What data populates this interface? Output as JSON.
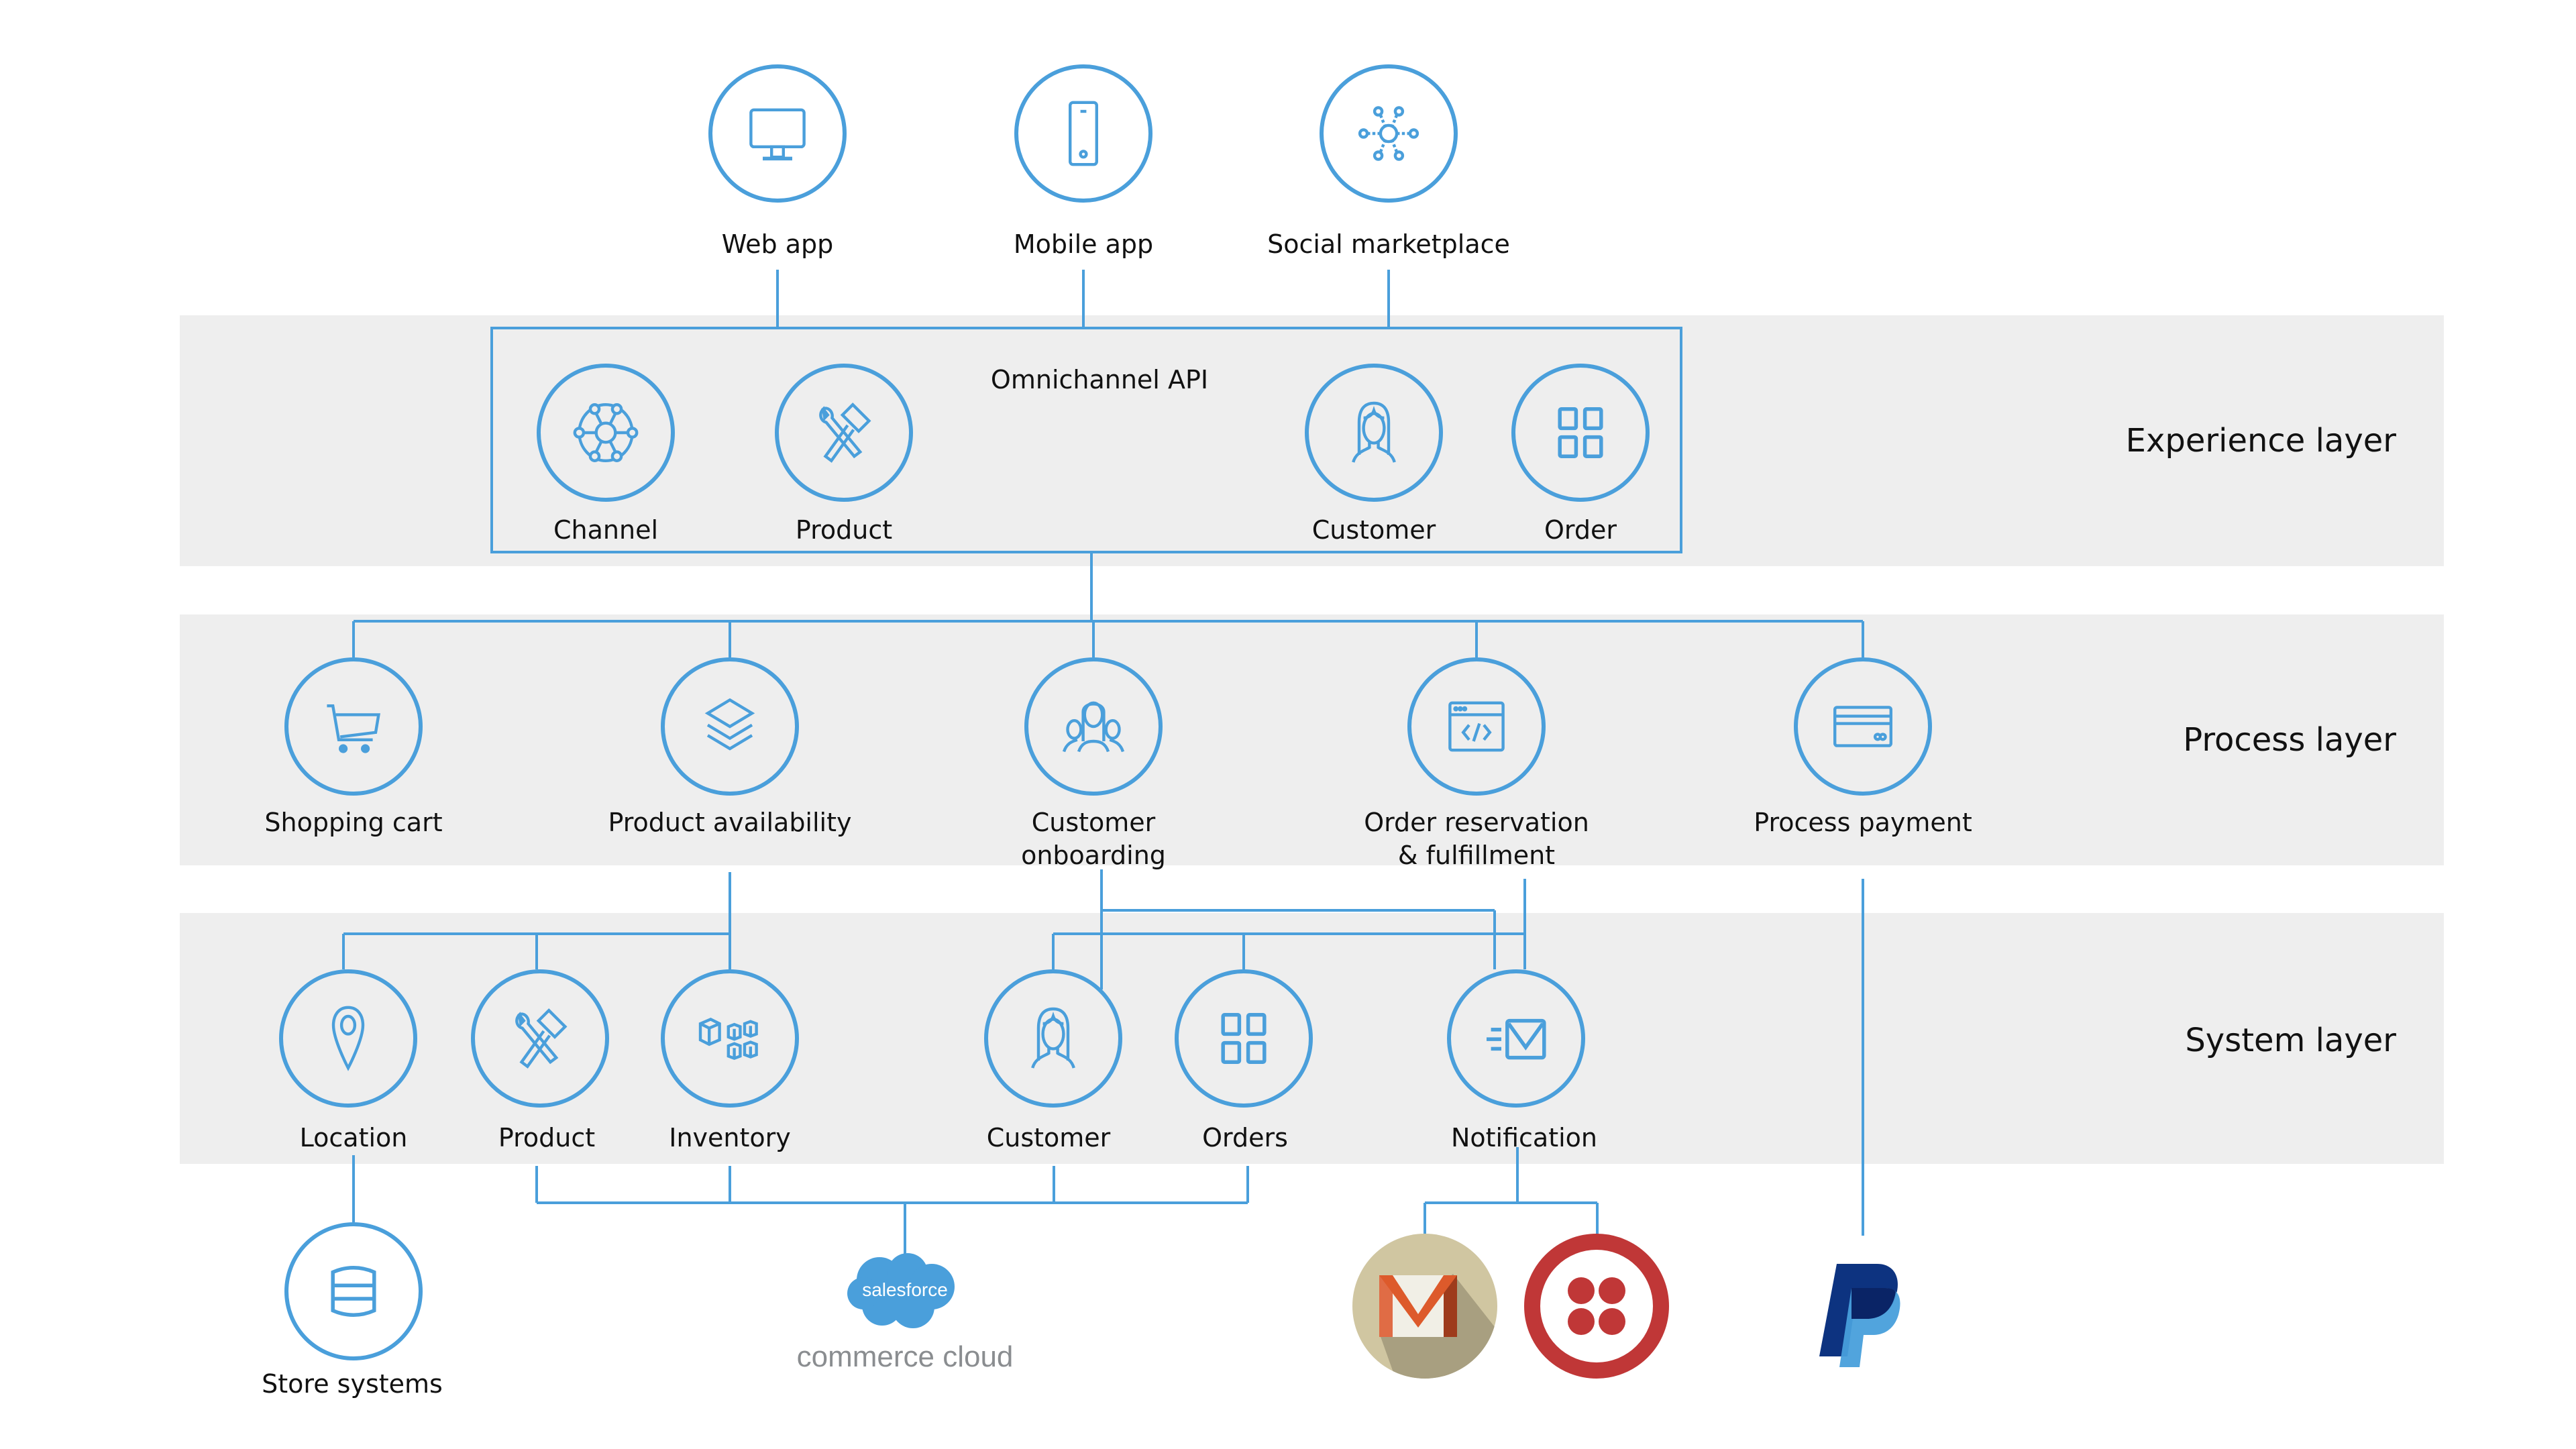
{
  "colors": {
    "accent": "#4a9fdb",
    "band": "#eeeeee",
    "text": "#111111",
    "salesforce": "#4a9fdb",
    "commerce_cloud_text": "#8a8d90",
    "gmail_bg": "#d0c6a1",
    "gmail_shadow": "#a89f80",
    "gmail_red": "#dd5a2b",
    "twilio_red": "#c03737",
    "paypal_dark": "#0d3380",
    "paypal_light": "#489fdb"
  },
  "channels": [
    {
      "label": "Web app",
      "icon": "monitor-icon"
    },
    {
      "label": "Mobile app",
      "icon": "smartphone-icon"
    },
    {
      "label": "Social marketplace",
      "icon": "social-network-icon"
    }
  ],
  "layers": {
    "experience": {
      "label": "Experience layer",
      "group_label": "Omnichannel API",
      "nodes": [
        {
          "label": "Channel",
          "icon": "hub-network-icon"
        },
        {
          "label": "Product",
          "icon": "tools-icon"
        },
        {
          "label": "Customer",
          "icon": "person-icon"
        },
        {
          "label": "Order",
          "icon": "grid-icon"
        }
      ]
    },
    "process": {
      "label": "Process layer",
      "nodes": [
        {
          "label": "Shopping cart",
          "icon": "cart-icon"
        },
        {
          "label": "Product availability",
          "icon": "layers-icon"
        },
        {
          "label": "Customer",
          "label2": "onboarding",
          "icon": "group-icon"
        },
        {
          "label": "Order reservation",
          "label2": "& fulfillment",
          "icon": "code-window-icon"
        },
        {
          "label": "Process payment",
          "icon": "credit-card-icon"
        }
      ]
    },
    "system": {
      "label": "System layer",
      "nodes": [
        {
          "label": "Location",
          "icon": "map-pin-icon"
        },
        {
          "label": "Product",
          "icon": "tools-icon"
        },
        {
          "label": "Inventory",
          "icon": "boxes-icon"
        },
        {
          "label": "Customer",
          "icon": "person-icon"
        },
        {
          "label": "Orders",
          "icon": "grid-icon"
        },
        {
          "label": "Notification",
          "icon": "email-send-icon"
        }
      ]
    }
  },
  "external": {
    "store_systems": {
      "label": "Store systems",
      "icon": "database-icon"
    },
    "salesforce": {
      "cloud_text": "salesforce",
      "product_text": "commerce cloud"
    },
    "gmail": {
      "icon": "gmail-logo-icon"
    },
    "twilio": {
      "icon": "twilio-logo-icon"
    },
    "paypal": {
      "icon": "paypal-logo-icon"
    }
  }
}
